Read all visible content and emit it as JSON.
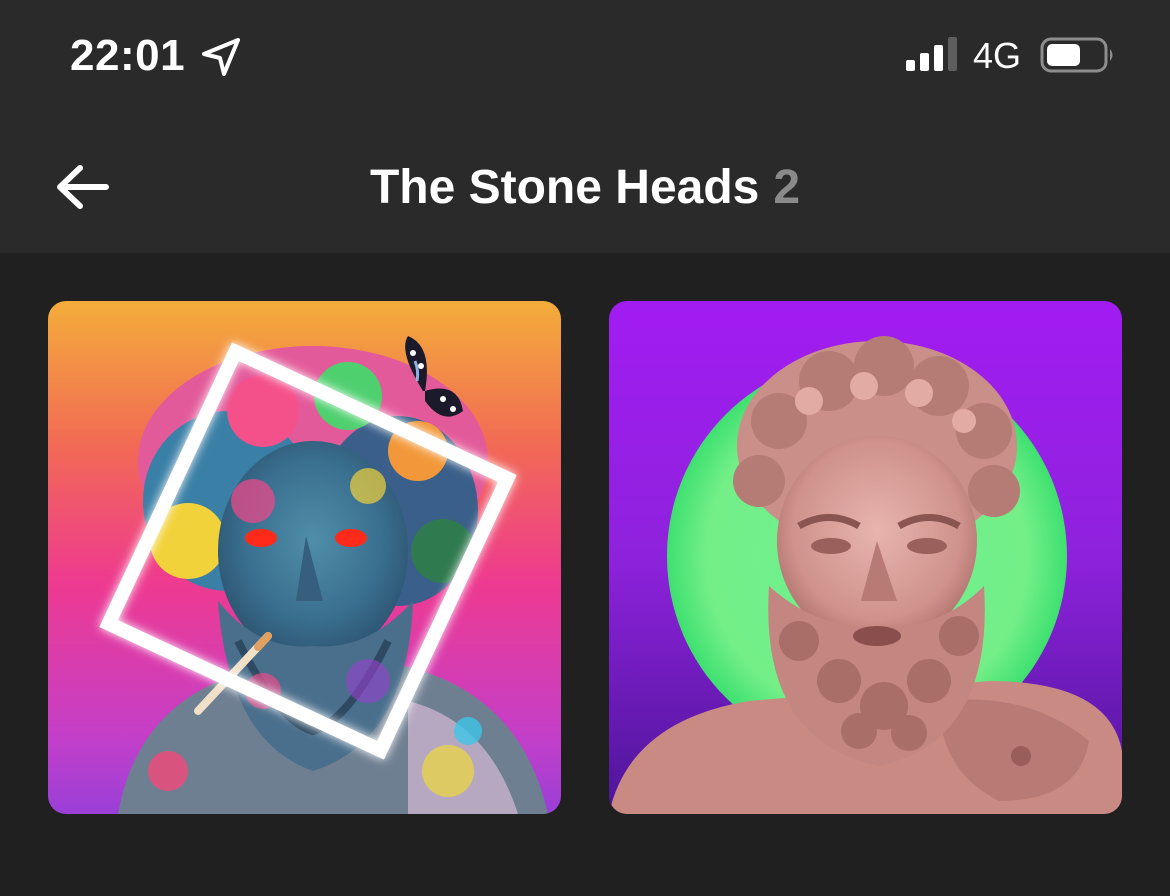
{
  "status_bar": {
    "time": "22:01",
    "network": "4G",
    "icons": [
      "location-arrow-icon",
      "cellular-signal-icon",
      "battery-icon"
    ]
  },
  "header": {
    "title": "The Stone Heads",
    "count": "2",
    "back_icon": "arrow-left-icon"
  },
  "collection": {
    "items": [
      {
        "artwork": "Neon statue head with butterfly, red eyes and white frame on orange-pink gradient"
      },
      {
        "artwork": "Pink marble bearded statue in front of green circle on purple background"
      }
    ]
  },
  "colors": {
    "header_bg": "#2a2a2a",
    "page_bg": "#202020",
    "count_gray": "#8a8a8a"
  }
}
